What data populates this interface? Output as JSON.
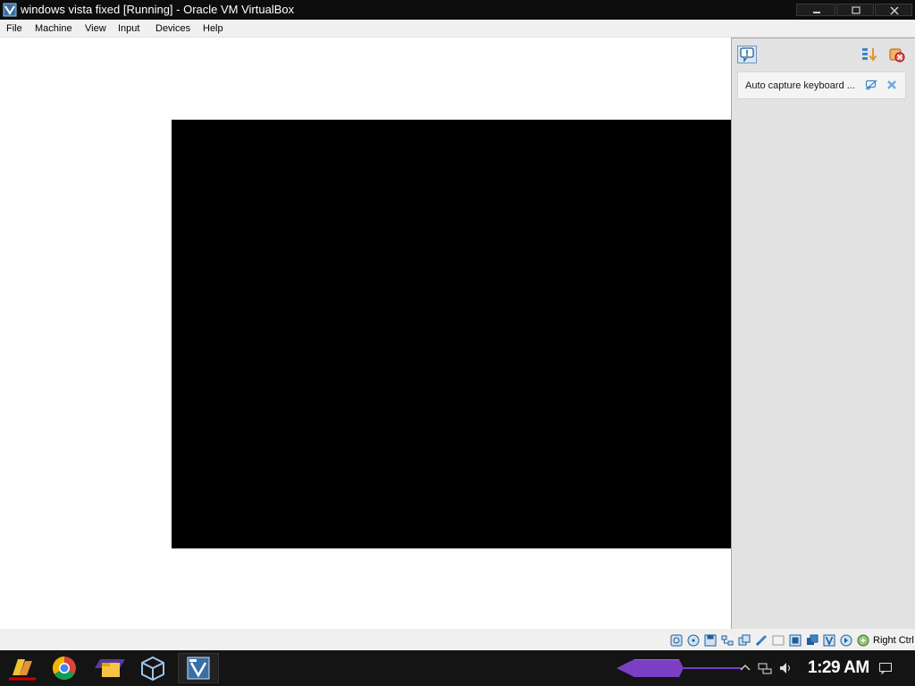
{
  "window": {
    "title": "windows vista fixed [Running] - Oracle VM VirtualBox",
    "controls": {
      "minimize": "–",
      "maximize": "□",
      "close": "✕"
    }
  },
  "menu": {
    "items": [
      {
        "label": "File"
      },
      {
        "label": "Machine"
      },
      {
        "label": "View"
      },
      {
        "label": "Input"
      },
      {
        "label": "Devices"
      },
      {
        "label": "Help"
      }
    ]
  },
  "notification_center": {
    "messages": [
      {
        "text": "Auto capture keyboard ..."
      }
    ]
  },
  "status_bar": {
    "indicators": [
      "hard-disk-icon",
      "optical-drive-icon",
      "floppy-icon",
      "network-icon",
      "usb-icon",
      "shared-folders-icon",
      "display-icon",
      "video-capture-icon",
      "recording-icon",
      "cpu-icon",
      "mouse-integration-icon",
      "keyboard-icon"
    ],
    "host_key": "Right Ctrl"
  },
  "taskbar": {
    "pinned": [
      "start-button-icon",
      "chrome-icon",
      "file-explorer-icon",
      "virtualbox-icon",
      "vista-vm-icon"
    ],
    "clock": "1:29 AM",
    "tray": [
      "show-hidden-icons-chevron",
      "network-icon",
      "volume-icon",
      "action-center-icon"
    ]
  },
  "colors": {
    "title_bar": "#0d0d0d",
    "menu_bar": "#f0f0f0",
    "vm_screen": "#000000",
    "notify_pane": "#e2e2e2",
    "taskbar": "#141414",
    "taskbar_accent": "#7b3fc4"
  }
}
